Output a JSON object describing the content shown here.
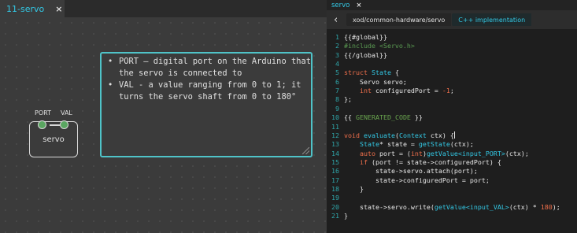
{
  "patch_tab": {
    "label": "11-servo",
    "close": "×"
  },
  "comment": {
    "items": [
      "PORT – digital port on the Arduino that the servo is connected to",
      "VAL - a value ranging from 0 to 1; it turns the servo shaft from 0 to 180°"
    ]
  },
  "node": {
    "title": "servo",
    "pins": [
      "PORT",
      "VAL"
    ]
  },
  "code_tab": {
    "label": "servo",
    "close": "×"
  },
  "breadcrumb": {
    "back": "‹",
    "path": "xod/common-hardware/servo",
    "active": "C++ implementation"
  },
  "code": {
    "lines": [
      {
        "n": "1",
        "segs": [
          [
            "",
            "{{#global}}"
          ]
        ]
      },
      {
        "n": "2",
        "segs": [
          [
            "cmt",
            "#include <Servo.h>"
          ]
        ]
      },
      {
        "n": "3",
        "segs": [
          [
            "",
            "{{/global}}"
          ]
        ]
      },
      {
        "n": "4",
        "segs": []
      },
      {
        "n": "5",
        "segs": [
          [
            "kw",
            "struct"
          ],
          [
            "",
            " "
          ],
          [
            "fn",
            "State"
          ],
          [
            "",
            " {"
          ]
        ]
      },
      {
        "n": "6",
        "segs": [
          [
            "",
            "    Servo servo;"
          ]
        ]
      },
      {
        "n": "7",
        "segs": [
          [
            "",
            "    "
          ],
          [
            "kw",
            "int"
          ],
          [
            "",
            " configuredPort = "
          ],
          [
            "num",
            "-1"
          ],
          [
            "",
            ";"
          ]
        ]
      },
      {
        "n": "8",
        "segs": [
          [
            "",
            "};"
          ]
        ]
      },
      {
        "n": "9",
        "segs": []
      },
      {
        "n": "10",
        "segs": [
          [
            "",
            "{{ "
          ],
          [
            "gen",
            "GENERATED_CODE"
          ],
          [
            "",
            " }}"
          ]
        ]
      },
      {
        "n": "11",
        "segs": []
      },
      {
        "n": "12",
        "segs": [
          [
            "kw",
            "void"
          ],
          [
            "",
            " "
          ],
          [
            "fn",
            "evaluate"
          ],
          [
            "",
            "("
          ],
          [
            "fn",
            "Context"
          ],
          [
            "",
            " ctx) {"
          ]
        ]
      },
      {
        "n": "13",
        "segs": [
          [
            "",
            "    "
          ],
          [
            "fn",
            "State"
          ],
          [
            "",
            "* state = "
          ],
          [
            "fn",
            "getState"
          ],
          [
            "",
            "(ctx);"
          ]
        ]
      },
      {
        "n": "14",
        "segs": [
          [
            "",
            "    "
          ],
          [
            "kw",
            "auto"
          ],
          [
            "",
            " port = ("
          ],
          [
            "kw",
            "int"
          ],
          [
            "",
            ")"
          ],
          [
            "fn",
            "getValue"
          ],
          [
            "tpl",
            "<input_PORT>"
          ],
          [
            "",
            "(ctx);"
          ]
        ]
      },
      {
        "n": "15",
        "segs": [
          [
            "",
            "    "
          ],
          [
            "kw",
            "if"
          ],
          [
            "",
            " (port != state->configuredPort) {"
          ]
        ]
      },
      {
        "n": "16",
        "segs": [
          [
            "",
            "        state->servo.attach(port);"
          ]
        ]
      },
      {
        "n": "17",
        "segs": [
          [
            "",
            "        state->configuredPort = port;"
          ]
        ]
      },
      {
        "n": "18",
        "segs": [
          [
            "",
            "    }"
          ]
        ]
      },
      {
        "n": "19",
        "segs": []
      },
      {
        "n": "20",
        "segs": [
          [
            "",
            "    state->servo.write("
          ],
          [
            "fn",
            "getValue"
          ],
          [
            "tpl",
            "<input_VAL>"
          ],
          [
            "",
            "(ctx) * "
          ],
          [
            "num",
            "180"
          ],
          [
            "",
            ");"
          ]
        ]
      },
      {
        "n": "21",
        "segs": [
          [
            "",
            "}"
          ]
        ]
      }
    ],
    "cursor_line": "12"
  }
}
